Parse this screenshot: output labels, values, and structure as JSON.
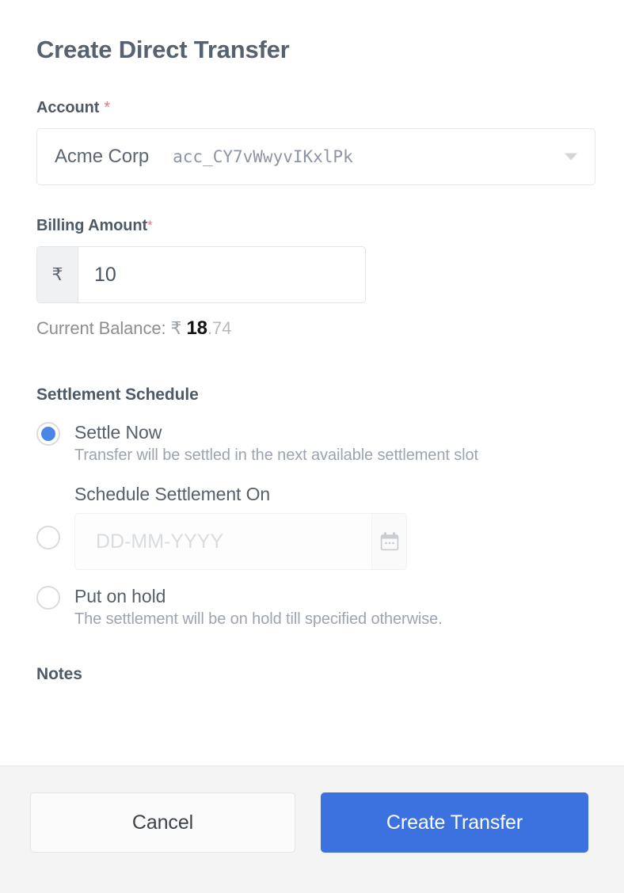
{
  "dialog": {
    "title": "Create Direct Transfer"
  },
  "account": {
    "label": "Account",
    "required_mark": "*",
    "selected_name": "Acme Corp",
    "selected_id": "acc_CY7vWwyvIKxlPk",
    "caret_icon": "chevron-down-icon"
  },
  "billing": {
    "label": "Billing Amount",
    "required_mark": "*",
    "currency_symbol": "₹",
    "value": "10",
    "placeholder": "",
    "balance_prefix": "Current Balance:",
    "balance_currency": "₹",
    "balance_integer": "18",
    "balance_decimal": ".74"
  },
  "settlement": {
    "section_title": "Settlement Schedule",
    "options": [
      {
        "title": "Settle Now",
        "description": "Transfer will be settled in the next available settlement slot",
        "selected": true
      },
      {
        "title": "Schedule Settlement On",
        "description": "",
        "selected": false,
        "date_placeholder": "DD-MM-YYYY",
        "date_value": "",
        "calendar_icon": "calendar-icon"
      },
      {
        "title": "Put on hold",
        "description": "The settlement will be on hold till specified otherwise.",
        "selected": false
      }
    ]
  },
  "notes": {
    "label": "Notes"
  },
  "footer": {
    "cancel_label": "Cancel",
    "submit_label": "Create Transfer"
  },
  "colors": {
    "accent": "#3b72e0",
    "radio_selected": "#4a86e8",
    "required": "#e8757a",
    "heading": "#566270",
    "footer_bg": "#f4f4f5"
  }
}
